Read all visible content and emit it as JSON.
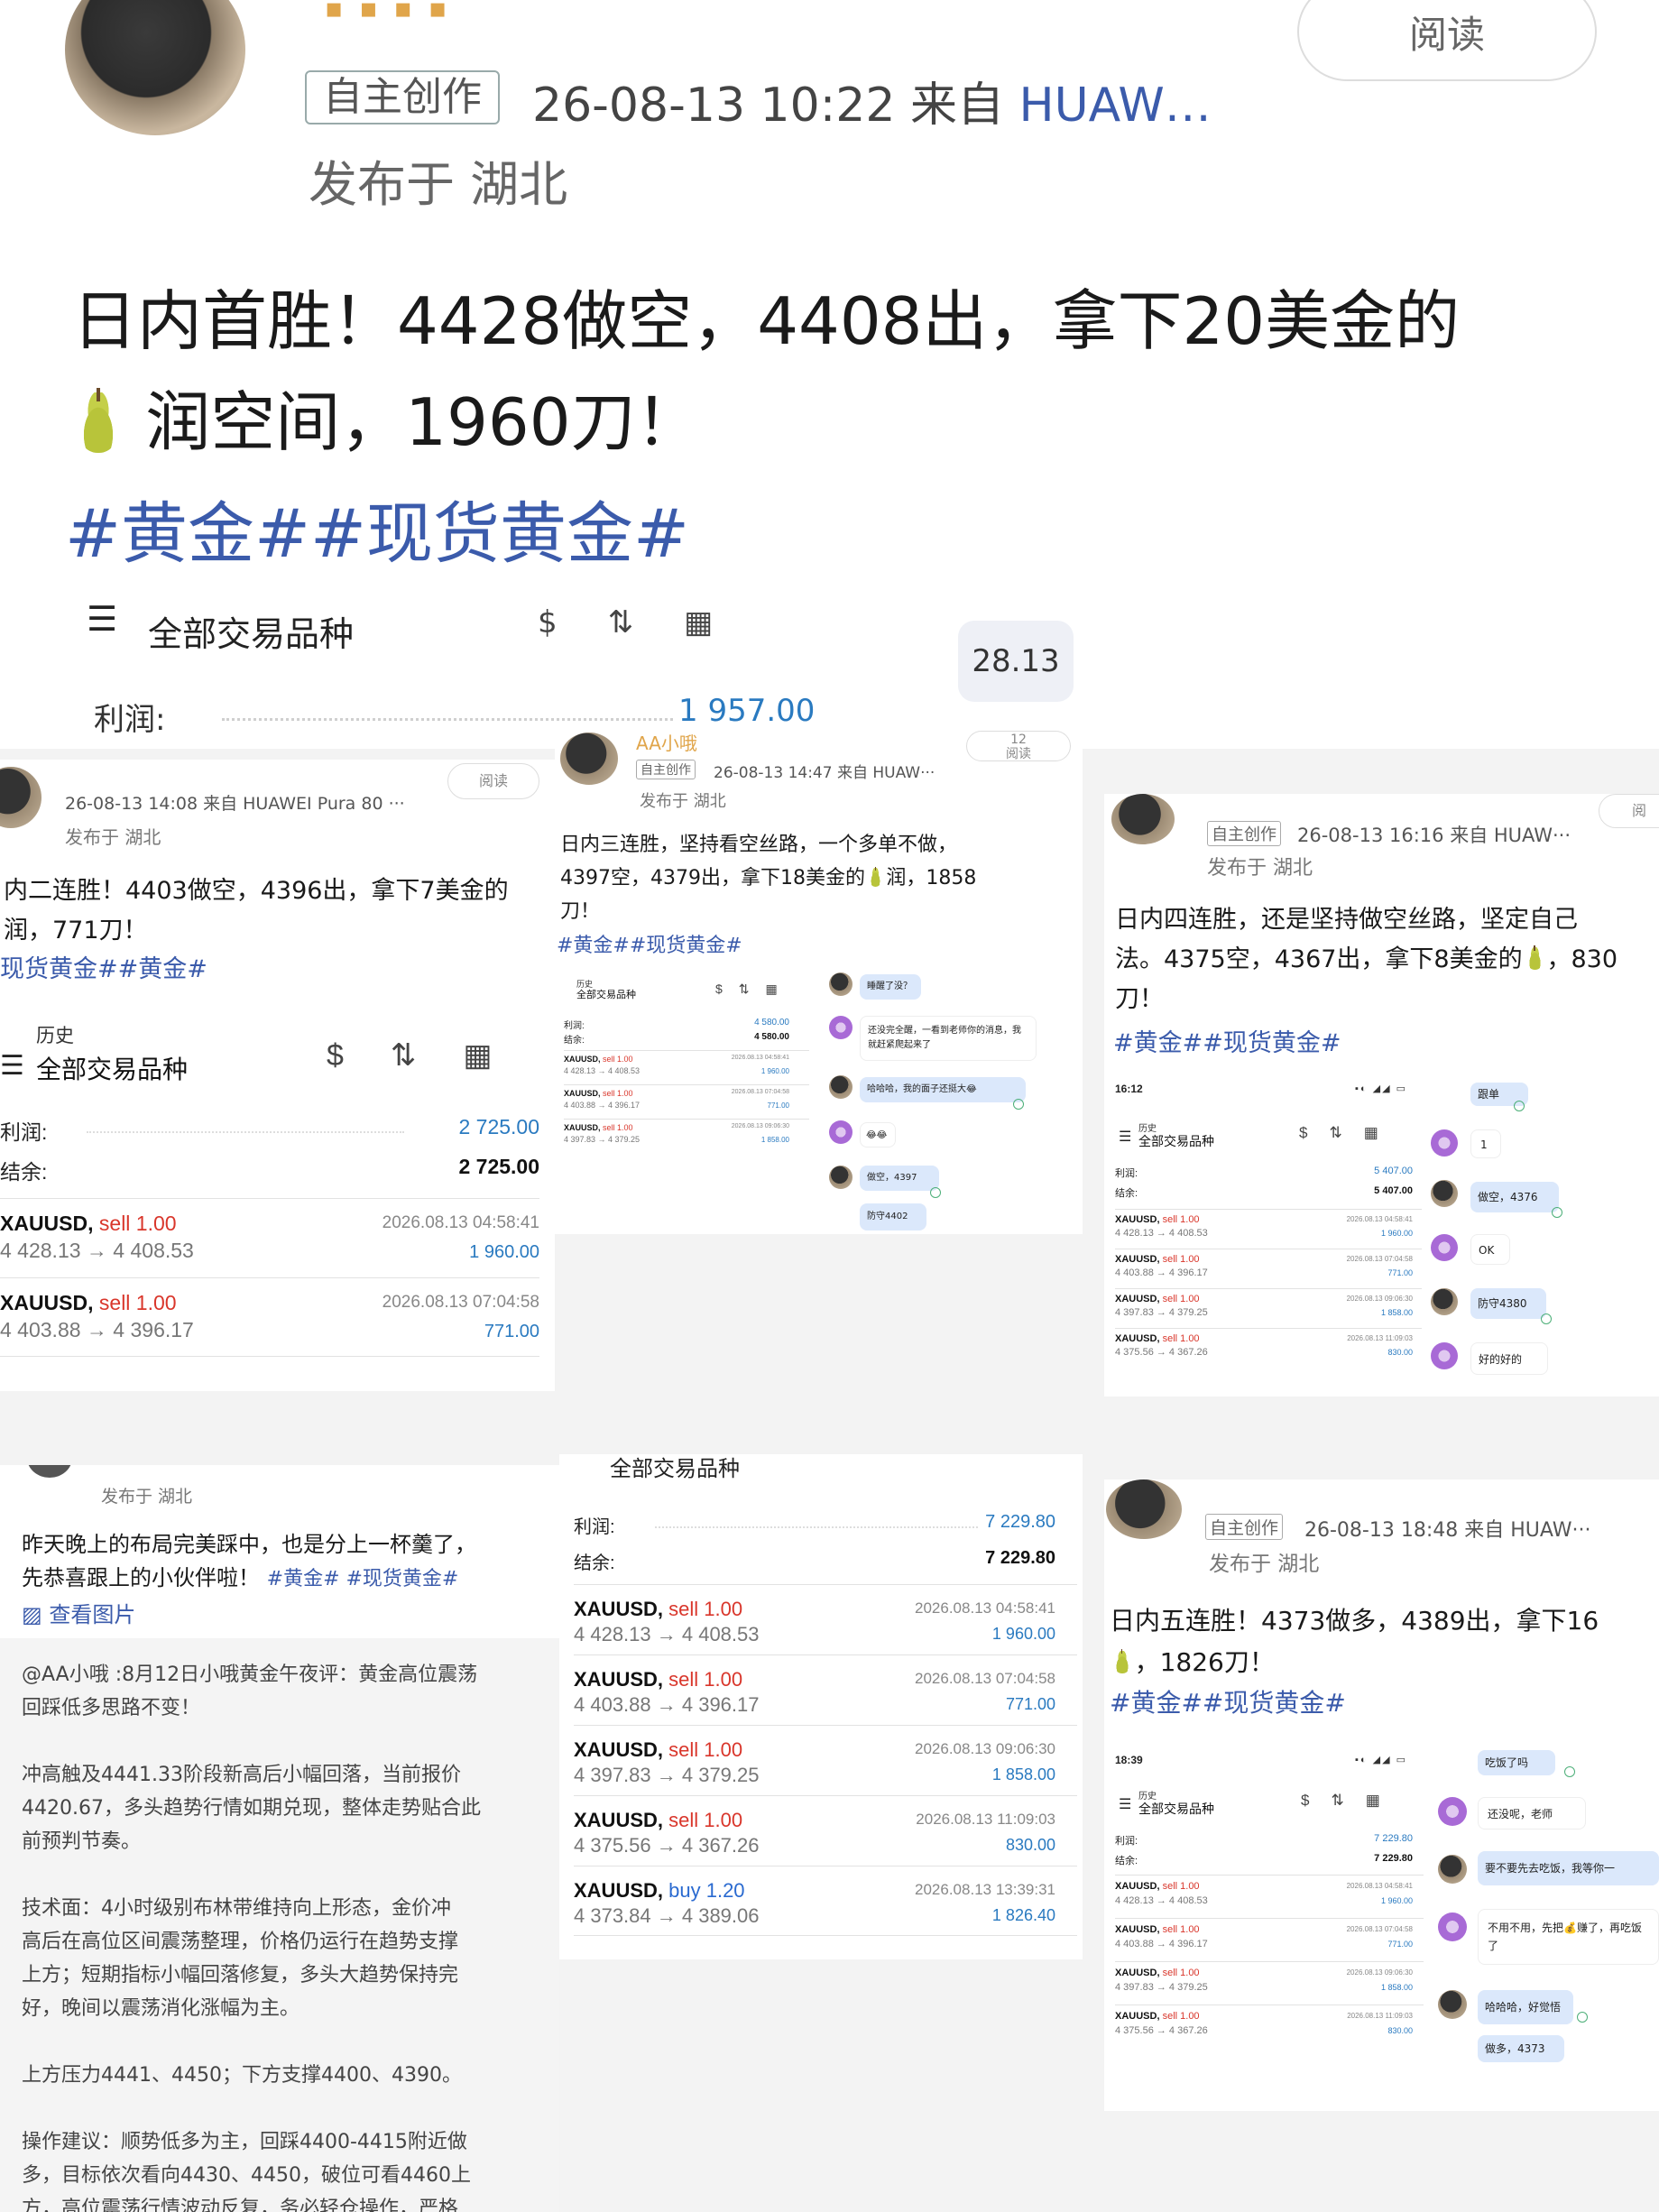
{
  "main_post": {
    "read_button": "阅读",
    "original_tag": "自主创作",
    "meta": "26-08-13 10:22 来自 ",
    "source": "HUAW…",
    "location": "发布于 湖北",
    "text_line1": "日内首胜！4428做空，4408出，拿下20美金的",
    "text_line2": "润空间，1960刀！",
    "hashtags": "#黄金##现货黄金#"
  },
  "account_strip": {
    "title": "全部交易品种",
    "profit_label": "利润:",
    "profit_value": "1 957.00",
    "bubble_value": "28.13",
    "icons": [
      "dollar-swap-icon",
      "sort-icon",
      "calendar-icon"
    ]
  },
  "card2": {
    "read": "阅读",
    "meta": "26-08-13 14:08 来自 HUAWEI Pura 80 ···",
    "location": "发布于 湖北",
    "text_line1": "内二连胜！4403做空，4396出，拿下7美金的",
    "text_line2": "润，771刀！",
    "hashtags": "现货黄金##黄金#",
    "table": {
      "history": "历史",
      "title": "全部交易品种",
      "profit_label": "利润:",
      "profit_value": "2 725.00",
      "balance_label": "结余:",
      "balance_value": "2 725.00",
      "trades": [
        {
          "sym": "XAUUSD,",
          "side": "sell 1.00",
          "prices": "4 428.13 → 4 408.53",
          "date": "2026.08.13 04:58:41",
          "pl": "1 960.00"
        },
        {
          "sym": "XAUUSD,",
          "side": "sell 1.00",
          "prices": "4 403.88 → 4 396.17",
          "date": "2026.08.13 07:04:58",
          "pl": "771.00"
        }
      ]
    }
  },
  "card3": {
    "user": "AA小哦",
    "read": "阅读",
    "read_count": "12",
    "original_tag": "自主创作",
    "meta": "26-08-13 14:47 来自 HUAW···",
    "location": "发布于 湖北",
    "text_line1": "日内三连胜，坚持看空丝路，一个多单不做，",
    "text_line2": "4397空，4379出，拿下18美金的",
    "text_line2b": "润，1858",
    "text_line3": "刀！",
    "hashtags": "#黄金##现货黄金#",
    "table": {
      "history": "历史",
      "title": "全部交易品种",
      "profit_label": "利润:",
      "profit_value": "4 580.00",
      "balance_label": "结余:",
      "balance_value": "4 580.00",
      "trades": [
        {
          "sym": "XAUUSD,",
          "side": "sell 1.00",
          "prices": "4 428.13 → 4 408.53",
          "date": "2026.08.13 04:58:41",
          "pl": "1 960.00"
        },
        {
          "sym": "XAUUSD,",
          "side": "sell 1.00",
          "prices": "4 403.88 → 4 396.17",
          "date": "2026.08.13 07:04:58",
          "pl": "771.00"
        },
        {
          "sym": "XAUUSD,",
          "side": "sell 1.00",
          "prices": "4 397.83 → 4 379.25",
          "date": "2026.08.13 09:06:30",
          "pl": "1 858.00"
        }
      ]
    },
    "chat": [
      "睡醒了没？",
      "还没完全醒，一看到老师你的消息，我就赶紧爬起来了",
      "哈哈哈，我的面子还挺大😂",
      "😂😂",
      "做空，4397",
      "防守4402"
    ]
  },
  "card4": {
    "read": "阅",
    "original_tag": "自主创作",
    "meta": "26-08-13 16:16 来自 HUAW···",
    "location": "发布于 湖北",
    "text_line1": "日内四连胜，还是坚持做空丝路，坚定自己",
    "text_line2": "法。4375空，4367出，拿下8美金的",
    "text_line2b": "，830",
    "text_line3": "刀！",
    "hashtags": "#黄金##现货黄金#",
    "phone_time": "16:12",
    "table": {
      "history": "历史",
      "title": "全部交易品种",
      "profit_label": "利润:",
      "profit_value": "5 407.00",
      "balance_label": "结余:",
      "balance_value": "5 407.00",
      "trades": [
        {
          "sym": "XAUUSD,",
          "side": "sell 1.00",
          "prices": "4 428.13 → 4 408.53",
          "date": "2026.08.13 04:58:41",
          "pl": "1 960.00"
        },
        {
          "sym": "XAUUSD,",
          "side": "sell 1.00",
          "prices": "4 403.88 → 4 396.17",
          "date": "2026.08.13 07:04:58",
          "pl": "771.00"
        },
        {
          "sym": "XAUUSD,",
          "side": "sell 1.00",
          "prices": "4 397.83 → 4 379.25",
          "date": "2026.08.13 09:06:30",
          "pl": "1 858.00"
        },
        {
          "sym": "XAUUSD,",
          "side": "sell 1.00",
          "prices": "4 375.56 → 4 367.26",
          "date": "2026.08.13 11:09:03",
          "pl": "830.00"
        }
      ]
    },
    "chat": [
      "跟单",
      "1",
      "做空，4376",
      "OK",
      "防守4380",
      "好的好的"
    ]
  },
  "comment_card": {
    "location": "发布于 湖北",
    "text_line1": "昨天晚上的布局完美踩中，也是分上一杯羹了，",
    "text_line2": "先恭喜跟上的小伙伴啦！",
    "hashtags": "#黄金# #现货黄金#",
    "view_images": "查看图片",
    "quote": [
      "@AA小哦 :8月12日小哦黄金午夜评：黄金高位震荡",
      "回踩低多思路不变！",
      "",
      "冲高触及4441.33阶段新高后小幅回落，当前报价",
      "4420.67，多头趋势行情如期兑现，整体走势贴合此",
      "前预判节奏。",
      "",
      "技术面：4小时级别布林带维持向上形态，金价冲",
      "高后在高位区间震荡整理，价格仍运行在趋势支撑",
      "上方；短期指标小幅回落修复，多头大趋势保持完",
      "好，晚间以震荡消化涨幅为主。",
      "",
      "上方压力4441、4450；下方支撑4400、4390。",
      "",
      "操作建议：顺势低多为主，回踩4400-4415附近做",
      "多，目标依次看向4430、4450，破位可看4460上",
      "方，高位震荡行情波动反复，务必轻仓操作，严格"
    ]
  },
  "table_card": {
    "header_clip": "全部交易品种",
    "profit_label": "利润:",
    "profit_value": "7 229.80",
    "balance_label": "结余:",
    "balance_value": "7 229.80",
    "trades": [
      {
        "sym": "XAUUSD,",
        "side": "sell 1.00",
        "prices": "4 428.13 → 4 408.53",
        "date": "2026.08.13 04:58:41",
        "pl": "1 960.00"
      },
      {
        "sym": "XAUUSD,",
        "side": "sell 1.00",
        "prices": "4 403.88 → 4 396.17",
        "date": "2026.08.13 07:04:58",
        "pl": "771.00"
      },
      {
        "sym": "XAUUSD,",
        "side": "sell 1.00",
        "prices": "4 397.83 → 4 379.25",
        "date": "2026.08.13 09:06:30",
        "pl": "1 858.00"
      },
      {
        "sym": "XAUUSD,",
        "side": "sell 1.00",
        "prices": "4 375.56 → 4 367.26",
        "date": "2026.08.13 11:09:03",
        "pl": "830.00"
      },
      {
        "sym": "XAUUSD,",
        "side": "buy 1.20",
        "prices": "4 373.84 → 4 389.06",
        "date": "2026.08.13 13:39:31",
        "pl": "1 826.40"
      }
    ]
  },
  "card6": {
    "original_tag": "自主创作",
    "meta": "26-08-13 18:48 来自 HUAW···",
    "location": "发布于 湖北",
    "text_line1": "日内五连胜！4373做多，4389出，拿下16",
    "text_line2": "，1826刀！",
    "hashtags": "#黄金##现货黄金#",
    "phone_time": "18:39",
    "table": {
      "history": "历史",
      "title": "全部交易品种",
      "profit_label": "利润:",
      "profit_value": "7 229.80",
      "balance_label": "结余:",
      "balance_value": "7 229.80",
      "trades": [
        {
          "sym": "XAUUSD,",
          "side": "sell 1.00",
          "prices": "4 428.13 → 4 408.53",
          "date": "2026.08.13 04:58:41",
          "pl": "1 960.00"
        },
        {
          "sym": "XAUUSD,",
          "side": "sell 1.00",
          "prices": "4 403.88 → 4 396.17",
          "date": "2026.08.13 07:04:58",
          "pl": "771.00"
        },
        {
          "sym": "XAUUSD,",
          "side": "sell 1.00",
          "prices": "4 397.83 → 4 379.25",
          "date": "2026.08.13 09:06:30",
          "pl": "1 858.00"
        },
        {
          "sym": "XAUUSD,",
          "side": "sell 1.00",
          "prices": "4 375.56 → 4 367.26",
          "date": "2026.08.13 11:09:03",
          "pl": "830.00"
        }
      ]
    },
    "chat": [
      "吃饭了吗",
      "还没呢，老师",
      "要不要先去吃饭，我等你一",
      "不用不用，先把💰赚了，再吃饭了",
      "哈哈哈，好觉悟",
      "做多，4373"
    ]
  }
}
